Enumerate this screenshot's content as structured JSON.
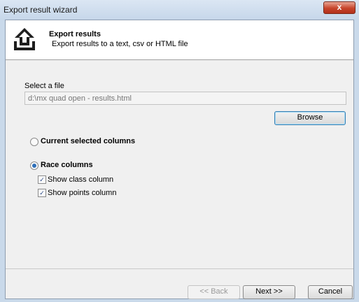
{
  "window": {
    "title": "Export result wizard",
    "close_label": "x"
  },
  "header": {
    "title": "Export results",
    "subtitle": "Export results to a text, csv or HTML file"
  },
  "file": {
    "label": "Select a file",
    "value": "d:\\mx quad open - results.html",
    "browse_label": "Browse"
  },
  "options": {
    "current_columns_label": "Current selected columns",
    "current_columns_checked": false,
    "race_columns_label": "Race columns",
    "race_columns_checked": true,
    "show_class_label": "Show class column",
    "show_class_checked": true,
    "show_points_label": "Show points column",
    "show_points_checked": true
  },
  "footer": {
    "back_label": "<< Back",
    "next_label": "Next >>",
    "cancel_label": "Cancel"
  },
  "colors": {
    "accent": "#3c7fb1",
    "radio_dot": "#2f6fb8",
    "close_button": "#c7452b"
  },
  "icons": {
    "header": "export-upload-icon"
  }
}
